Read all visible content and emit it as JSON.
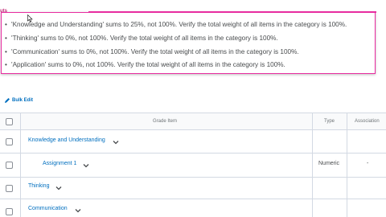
{
  "errors": {
    "label": "uts",
    "items": [
      "'Knowledge and Understanding' sums to 25%, not 100%. Verify the total weight of all items in the category is 100%.",
      "'Thinking' sums to 0%, not 100%. Verify the total weight of all items in the category is 100%.",
      "'Communication' sums to 0%, not 100%. Verify the total weight of all items in the category is 100%.",
      "'Application' sums to 0%, not 100%. Verify the total weight of all items in the category is 100%."
    ],
    "accent_color": "#e82ca0"
  },
  "toolbar": {
    "bulk_edit_label": "Bulk Edit"
  },
  "table": {
    "headers": {
      "grade_item": "Grade Item",
      "type": "Type",
      "association": "Association"
    },
    "rows": [
      {
        "name": "Knowledge and Understanding",
        "type": "",
        "association": ""
      },
      {
        "name": "Assignment 1",
        "type": "Numeric",
        "association": "-"
      },
      {
        "name": "Thinking",
        "type": "",
        "association": ""
      },
      {
        "name": "Communication",
        "type": "",
        "association": ""
      }
    ]
  },
  "colors": {
    "link": "#006fbf",
    "text": "#494c4e",
    "border": "#d3d9e3"
  }
}
